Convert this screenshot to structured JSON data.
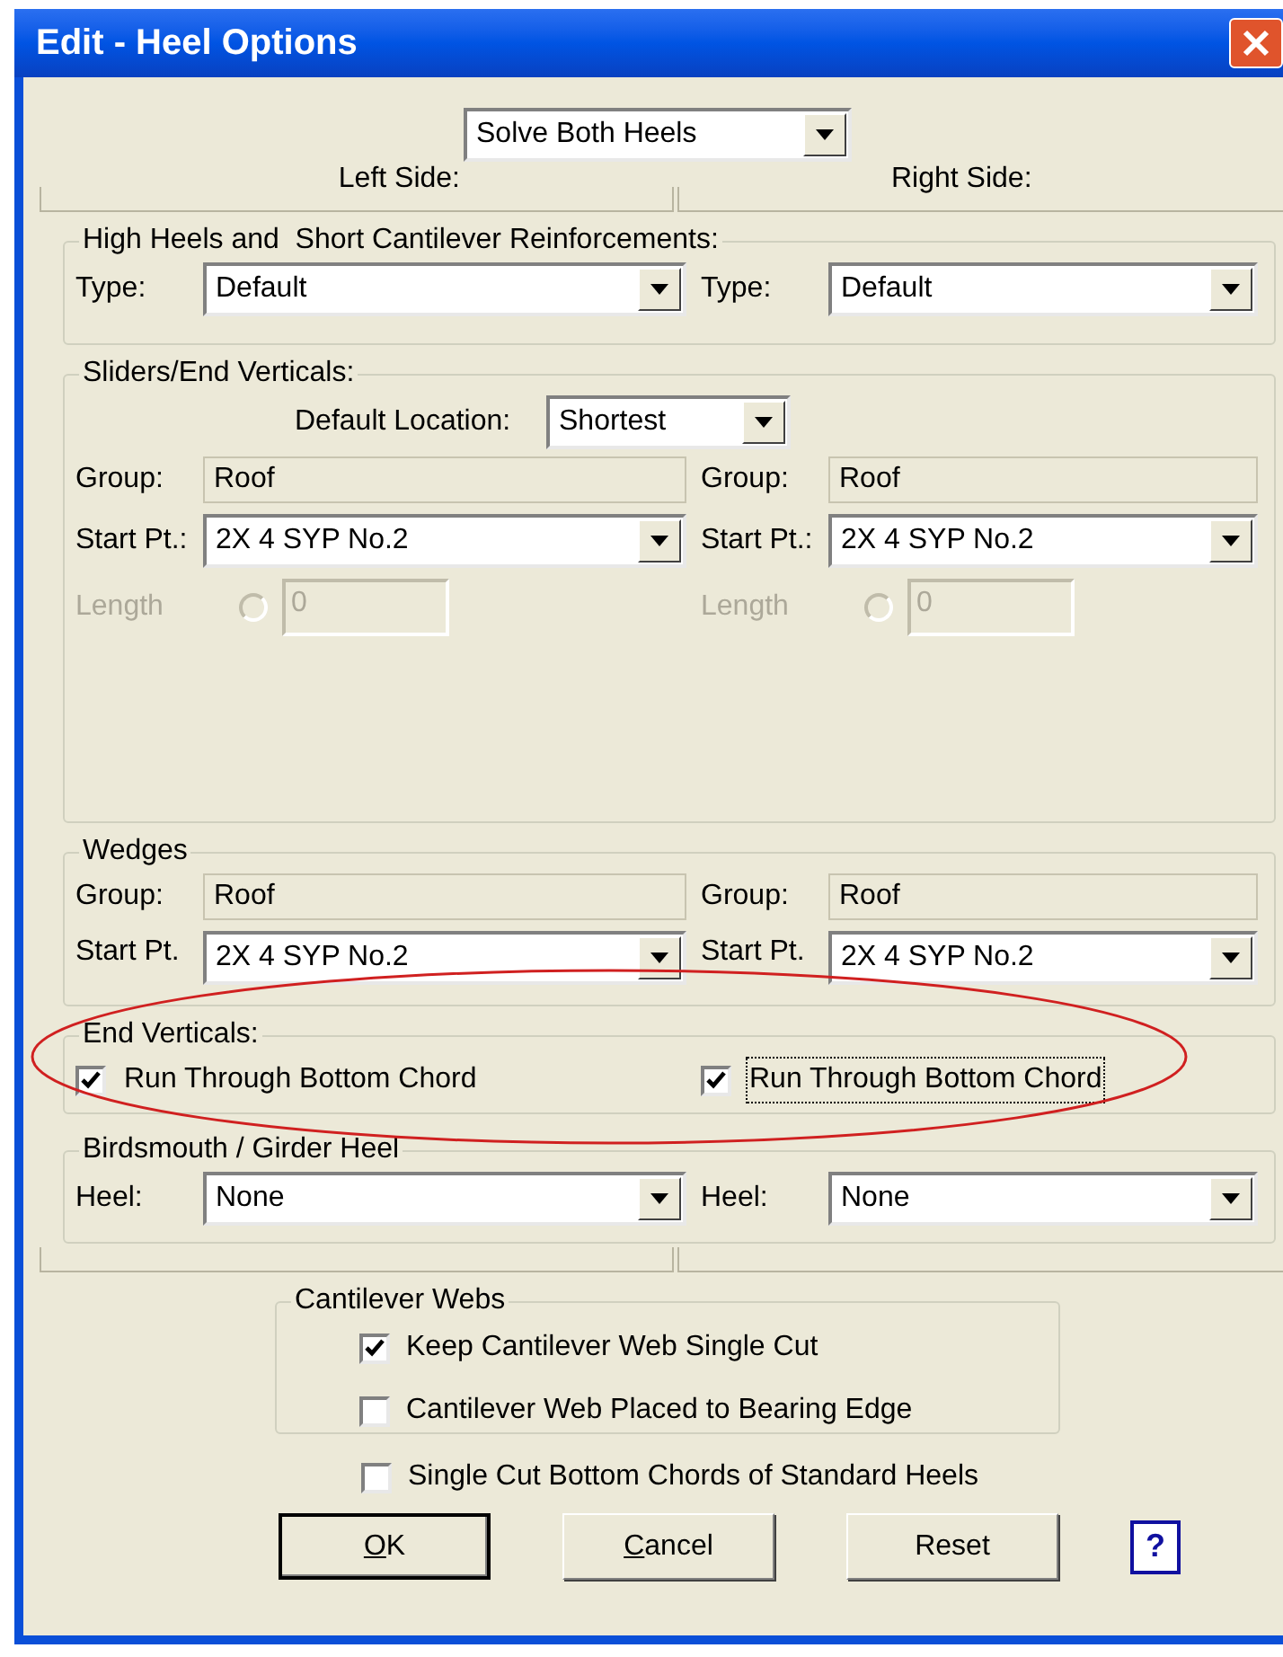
{
  "window": {
    "title": "Edit - Heel Options"
  },
  "solve_mode": {
    "value": "Solve Both Heels"
  },
  "side_labels": [
    "Left Side:",
    "Right Side:"
  ],
  "reinforcements": {
    "title": "High Heels and  Short Cantilever Reinforcements:",
    "sides": [
      {
        "label": "Type:",
        "value": "Default"
      },
      {
        "label": "Type:",
        "value": "Default"
      }
    ]
  },
  "sliders": {
    "title": "Sliders/End Verticals:",
    "default_location": {
      "label": "Default Location:",
      "value": "Shortest"
    },
    "sides": [
      {
        "group_label": "Group:",
        "group_value": "Roof",
        "start_label": "Start Pt.:",
        "start_value": "2X 4 SYP No.2",
        "length_label": "Length",
        "length_value": "0",
        "length_disabled": true,
        "length_selected": false
      },
      {
        "group_label": "Group:",
        "group_value": "Roof",
        "start_label": "Start Pt.:",
        "start_value": "2X 4 SYP No.2",
        "length_label": "Length",
        "length_value": "0",
        "length_disabled": true,
        "length_selected": false
      }
    ]
  },
  "wedges": {
    "title": "Wedges",
    "sides": [
      {
        "group_label": "Group:",
        "group_value": "Roof",
        "start_label": "Start Pt.",
        "start_value": "2X 4 SYP No.2"
      },
      {
        "group_label": "Group:",
        "group_value": "Roof",
        "start_label": "Start Pt.",
        "start_value": "2X 4 SYP No.2"
      }
    ]
  },
  "end_verticals": {
    "title": "End Verticals:",
    "sides": [
      {
        "label": "Run Through Bottom Chord",
        "checked": true,
        "focused": false
      },
      {
        "label": "Run Through Bottom Chord",
        "checked": true,
        "focused": true
      }
    ]
  },
  "birdsmouth": {
    "title": "Birdsmouth / Girder Heel",
    "sides": [
      {
        "label": "Heel:",
        "value": "None"
      },
      {
        "label": "Heel:",
        "value": "None"
      }
    ]
  },
  "cantilever_webs": {
    "title": "Cantilever Webs",
    "options": [
      {
        "label": "Keep Cantilever Web Single Cut",
        "checked": true
      },
      {
        "label": "Cantilever Web Placed to Bearing Edge",
        "checked": false
      }
    ]
  },
  "single_cut": {
    "label": "Single Cut Bottom Chords of Standard Heels",
    "checked": false
  },
  "buttons": [
    {
      "kind": "push",
      "label": "OK",
      "first_letter_underlined": true,
      "default": true
    },
    {
      "kind": "push",
      "label": "Cancel",
      "first_letter_underlined": true,
      "default": false
    },
    {
      "kind": "push",
      "label": "Reset",
      "first_letter_underlined": false,
      "default": false
    },
    {
      "kind": "help",
      "label": "?"
    }
  ]
}
